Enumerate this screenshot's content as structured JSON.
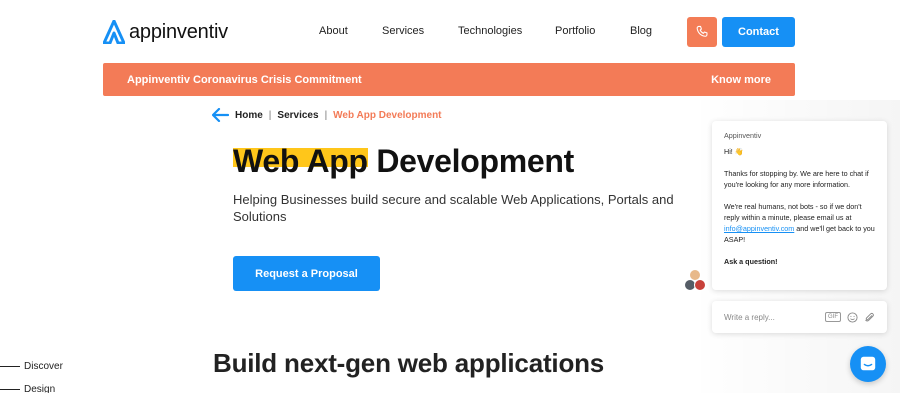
{
  "header": {
    "logo_text": "appinventiv",
    "nav": [
      {
        "label": "About"
      },
      {
        "label": "Services"
      },
      {
        "label": "Technologies"
      },
      {
        "label": "Portfolio"
      },
      {
        "label": "Blog"
      }
    ],
    "phone_icon": "phone-icon",
    "contact_label": "Contact"
  },
  "banner": {
    "text": "Appinventiv Coronavirus Crisis Commitment",
    "cta": "Know more"
  },
  "breadcrumb": {
    "back_icon": "back-arrow-icon",
    "home": "Home",
    "sep": "|",
    "services": "Services",
    "current": "Web App Development"
  },
  "hero": {
    "title_highlight": "Web App",
    "title_rest": "Development",
    "subtitle": "Helping Businesses build secure and scalable Web Applications, Portals and Solutions",
    "cta": "Request a Proposal"
  },
  "side_nav": [
    {
      "label": "Discover"
    },
    {
      "label": "Design"
    }
  ],
  "section": {
    "title": "Build next-gen web applications"
  },
  "chat": {
    "from": "Appinventiv",
    "greeting": "Hi! 👋",
    "p1": "Thanks for stopping by. We are here to chat if you're looking for any more information.",
    "p2_before": "We're real humans, not bots - so if we don't reply within a minute, please email us at ",
    "email": "info@appinventiv.com",
    "p2_after": " and we'll get back to you ASAP!",
    "ask": "Ask a question!",
    "input_placeholder": "Write a reply...",
    "gif_label": "GIF",
    "icons": [
      "gif-icon",
      "emoji-icon",
      "attachment-icon",
      "messenger-icon"
    ]
  },
  "colors": {
    "brand_blue": "#1690f5",
    "accent_orange": "#f37b57",
    "highlight_yellow": "#ffc61a"
  }
}
